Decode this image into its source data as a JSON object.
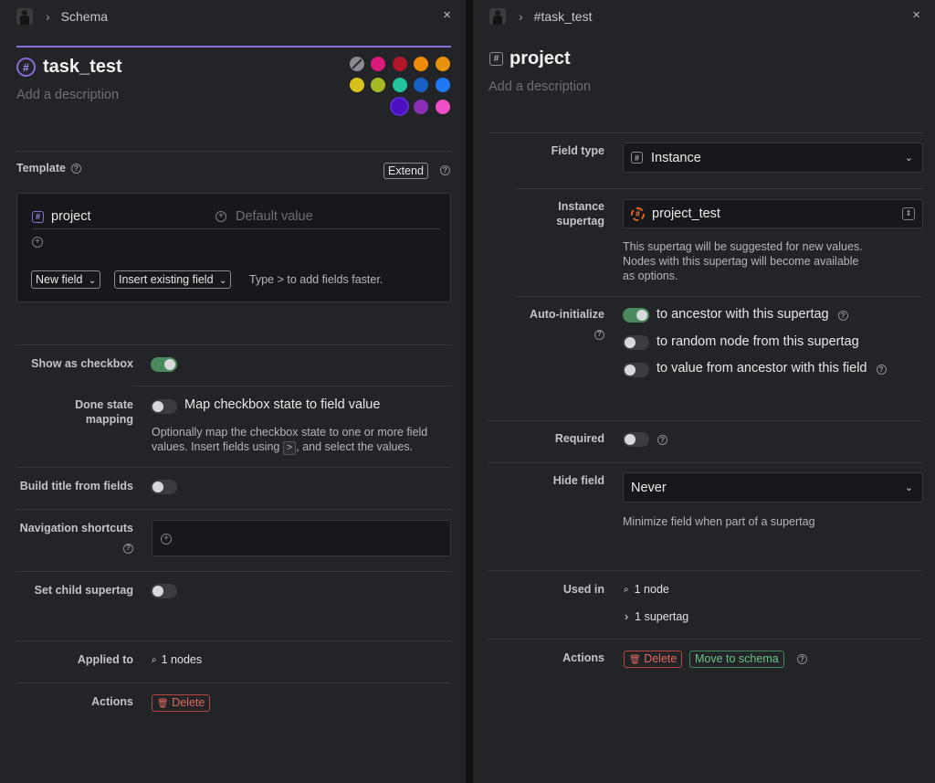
{
  "left": {
    "breadcrumb": "Schema",
    "close": "×",
    "tag_symbol": "#",
    "title": "task_test",
    "description_placeholder": "Add a description",
    "template_label": "Template",
    "extend_label": "Extend",
    "field_name": "project",
    "default_value_placeholder": "Default value",
    "new_field_label": "New field",
    "insert_existing_label": "Insert existing field",
    "type_hint": "Type > to add fields faster.",
    "show_checkbox_label": "Show as checkbox",
    "done_state_label_1": "Done state",
    "done_state_label_2": "mapping",
    "map_checkbox_label": "Map checkbox state to field value",
    "map_help_1": "Optionally map the checkbox state to one or more field",
    "map_help_2a": "values. Insert fields using",
    "map_help_key": ">",
    "map_help_2b": ", and select the values.",
    "build_title_label": "Build title from fields",
    "nav_shortcuts_label": "Navigation shortcuts",
    "child_supertag_label": "Set child supertag",
    "applied_to_label": "Applied to",
    "applied_to_value": "1 nodes",
    "actions_label": "Actions",
    "delete_label": "Delete",
    "toggles": {
      "show_checkbox": true,
      "done_state": false,
      "build_title": false,
      "child_supertag": false
    },
    "colors": [
      "#8a8b93",
      "#d81b7a",
      "#b0152a",
      "#f08a0a",
      "#e6920c",
      "#d8c21a",
      "#a6b924",
      "#22c29a",
      "#1760c4",
      "#1e78f5",
      "#4c10c2",
      "#8a2fb5",
      "#ee4fc6"
    ],
    "selected_color": "#4c10c2"
  },
  "right": {
    "breadcrumb": "#task_test",
    "close": "×",
    "title": "project",
    "description_placeholder": "Add a description",
    "field_type_label": "Field type",
    "field_type_value": "Instance",
    "instance_label_1": "Instance",
    "instance_label_2": "supertag",
    "instance_value": "project_test",
    "instance_help_1": "This supertag will be suggested for new values.",
    "instance_help_2": "Nodes with this supertag will become available",
    "instance_help_3": "as options.",
    "auto_init_label": "Auto-initialize",
    "auto_init_1": "to ancestor with this supertag",
    "auto_init_2": "to random node from this supertag",
    "auto_init_3": "to value from ancestor with this field",
    "auto_toggles": [
      true,
      false,
      false
    ],
    "required_label": "Required",
    "required_on": false,
    "hide_field_label": "Hide field",
    "hide_field_value": "Never",
    "hide_field_help": "Minimize field when part of a supertag",
    "used_in_label": "Used in",
    "used_in_nodes": "1 node",
    "used_in_supertags": "1 supertag",
    "actions_label": "Actions",
    "delete_label": "Delete",
    "move_label": "Move to schema"
  }
}
